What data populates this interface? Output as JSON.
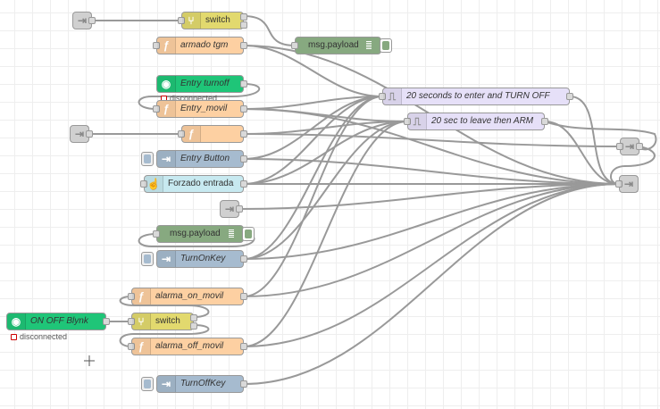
{
  "flow": {
    "nodes": [
      {
        "id": "switch_top",
        "label": "switch",
        "italic": false
      },
      {
        "id": "armado_tgm",
        "label": "armado tgm",
        "italic": true
      },
      {
        "id": "msg_payload_1",
        "label": "msg.payload",
        "italic": false
      },
      {
        "id": "entry_turnoff",
        "label": "Entry turnoff",
        "italic": true,
        "status": "disconnected"
      },
      {
        "id": "entry_movil",
        "label": "Entry_movil",
        "italic": true
      },
      {
        "id": "func_blank",
        "label": "",
        "italic": false
      },
      {
        "id": "entry_button",
        "label": "Entry Button",
        "italic": true
      },
      {
        "id": "forzado_entrada",
        "label": "Forzado entrada",
        "italic": false
      },
      {
        "id": "msg_payload_2",
        "label": "msg.payload",
        "italic": false
      },
      {
        "id": "turnonkey",
        "label": "TurnOnKey",
        "italic": true
      },
      {
        "id": "alarma_on_movil",
        "label": "alarma_on_movil",
        "italic": true
      },
      {
        "id": "on_off_blynk",
        "label": "ON OFF Blynk",
        "italic": true,
        "status": "disconnected"
      },
      {
        "id": "switch_bottom",
        "label": "switch",
        "italic": false
      },
      {
        "id": "alarma_off_movil",
        "label": "alarma_off_movil",
        "italic": true
      },
      {
        "id": "turnoffkey",
        "label": "TurnOffKey",
        "italic": true
      },
      {
        "id": "delay_enter",
        "label": "20 seconds to enter and TURN OFF",
        "italic": true
      },
      {
        "id": "delay_leave",
        "label": "20 sec to leave then ARM",
        "italic": true
      }
    ]
  },
  "colors": {
    "function": "#fdd0a2",
    "switch": "#e2d96e",
    "debug": "#87a980",
    "blynk": "#1fc578",
    "link": "#a6bbcf",
    "inject": "#c7e9f0",
    "delay": "#e6e0f8",
    "wire": "#999999"
  },
  "icons": {
    "function": "function-icon",
    "switch": "switch-icon",
    "link": "arrow-icon",
    "inject": "hand-icon",
    "delay": "timer-icon",
    "blynk": "globe-icon",
    "debug": "list-icon"
  }
}
